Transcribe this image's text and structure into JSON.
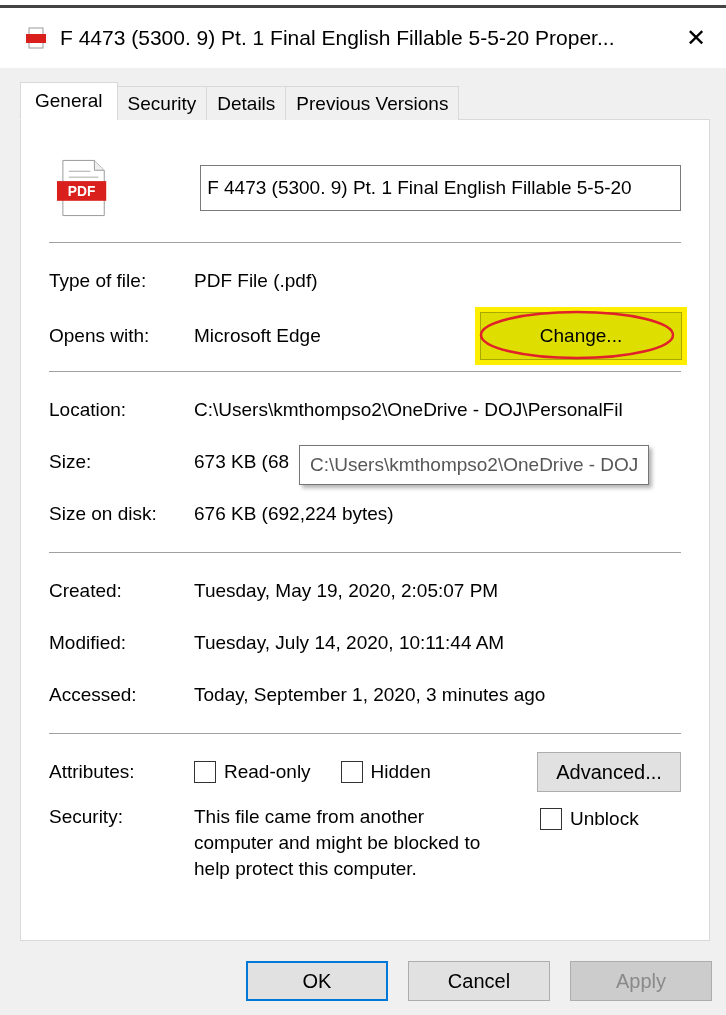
{
  "window": {
    "title": "F 4473 (5300. 9) Pt. 1 Final English Fillable 5-5-20 Proper...",
    "close": "✕"
  },
  "tabs": [
    {
      "label": "General",
      "selected": true
    },
    {
      "label": "Security",
      "selected": false
    },
    {
      "label": "Details",
      "selected": false
    },
    {
      "label": "Previous Versions",
      "selected": false
    }
  ],
  "file_icon": {
    "badge": "PDF"
  },
  "file_name": {
    "value": "F 4473 (5300. 9) Pt. 1 Final English Fillable 5-5-20"
  },
  "type_section": [
    {
      "label": "Type of file:",
      "value": "PDF File (.pdf)"
    },
    {
      "label": "Opens with:",
      "value": "Microsoft Edge",
      "button": {
        "label": "Change...",
        "highlighted": true
      }
    }
  ],
  "location_section": [
    {
      "label": "Location:",
      "value": "C:\\Users\\kmthompso2\\OneDrive - DOJ\\PersonalFil"
    },
    {
      "label": "Size:",
      "value": "673 KB (68"
    },
    {
      "label": "Size on disk:",
      "value": "676 KB (692,224 bytes)"
    }
  ],
  "tooltip": "C:\\Users\\kmthompso2\\OneDrive - DOJ",
  "date_section": [
    {
      "label": "Created:",
      "value": "Tuesday, May 19, 2020, 2:05:07 PM"
    },
    {
      "label": "Modified:",
      "value": "Tuesday, July 14, 2020, 10:11:44 AM"
    },
    {
      "label": "Accessed:",
      "value": "Today, September 1, 2020, 3 minutes ago"
    }
  ],
  "attributes": {
    "label": "Attributes:",
    "checkboxes": [
      {
        "label": "Read-only",
        "checked": false
      },
      {
        "label": "Hidden",
        "checked": false
      }
    ],
    "button": "Advanced..."
  },
  "security": {
    "label": "Security:",
    "text": "This file came from another computer and might be blocked to help protect this computer.",
    "unblock": {
      "label": "Unblock",
      "checked": false
    }
  },
  "buttons": [
    {
      "label": "OK",
      "default": true,
      "disabled": false
    },
    {
      "label": "Cancel",
      "default": false,
      "disabled": false
    },
    {
      "label": "Apply",
      "default": false,
      "disabled": true
    }
  ]
}
